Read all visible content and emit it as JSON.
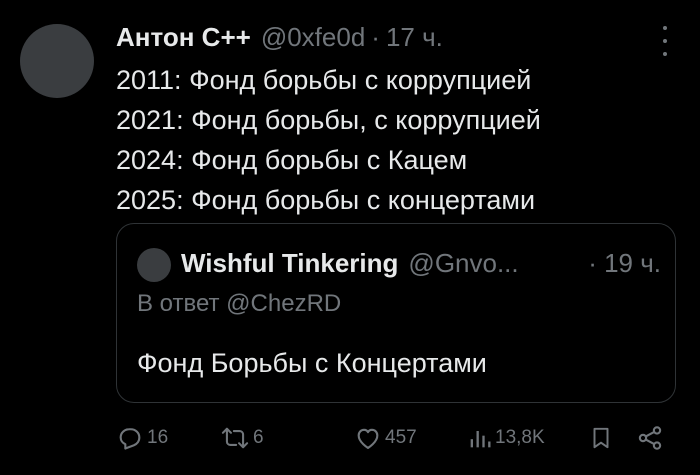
{
  "author": {
    "name": "Антон С++",
    "handle": "@0xfe0d",
    "separator": "·",
    "time": "17 ч."
  },
  "body_lines": [
    "2011: Фонд борьбы с коррупцией",
    "2021: Фонд борьбы, с коррупцией",
    "2024: Фонд борьбы с Кацем",
    "2025: Фонд борьбы с концертами"
  ],
  "quoted": {
    "name": "Wishful Tinkering",
    "handle": "@Gnvo...",
    "time": "· 19 ч.",
    "reply_to": "В ответ @ChezRD",
    "text": "Фонд Борьбы с Концертами"
  },
  "actions": {
    "replies": "16",
    "reposts": "6",
    "likes": "457",
    "views": "13,8K"
  },
  "icons": {
    "more": "more-icon",
    "reply": "reply-icon",
    "repost": "repost-icon",
    "like": "like-icon",
    "views": "views-icon",
    "bookmark": "bookmark-icon",
    "share": "share-icon"
  },
  "colors": {
    "background": "#000000",
    "text": "#e7e9ea",
    "secondary": "#71767b",
    "border": "#2f3336"
  }
}
